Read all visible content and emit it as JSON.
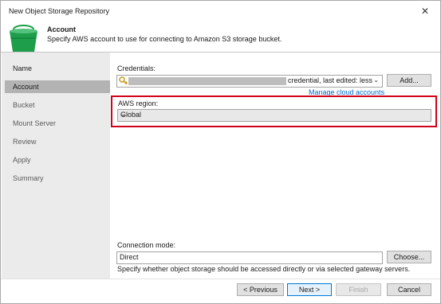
{
  "window": {
    "title": "New Object Storage Repository",
    "close_glyph": "✕"
  },
  "header": {
    "icon": "bucket-icon",
    "title": "Account",
    "description": "Specify AWS account to use for connecting to Amazon S3 storage bucket."
  },
  "steps": [
    {
      "label": "Name"
    },
    {
      "label": "Account",
      "active": true
    },
    {
      "label": "Bucket"
    },
    {
      "label": "Mount Server"
    },
    {
      "label": "Review"
    },
    {
      "label": "Apply"
    },
    {
      "label": "Summary"
    }
  ],
  "credentials": {
    "label": "Credentials:",
    "icon": "key-icon",
    "value_visible": "credential, last edited: less t",
    "add_label": "Add...",
    "manage_link": "Manage cloud accounts"
  },
  "region": {
    "label": "AWS region:",
    "value": "Global",
    "highlight_color": "#d0021b"
  },
  "connection": {
    "label": "Connection mode:",
    "value": "Direct",
    "choose_label": "Choose...",
    "hint": "Specify whether object storage should be accessed directly or via selected gateway servers."
  },
  "footer": {
    "previous": "< Previous",
    "next": "Next >",
    "finish": "Finish",
    "cancel": "Cancel"
  },
  "colors": {
    "accent": "#0078d7",
    "link": "#0066cc",
    "bucket_green": "#1e9e4a"
  }
}
